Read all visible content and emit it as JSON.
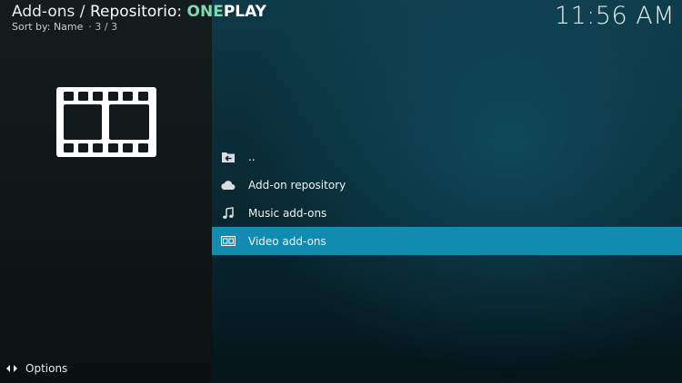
{
  "header": {
    "prefix": "Add-ons / ",
    "repo_label": "Repositorio: ",
    "repo_name_accent": "ONE",
    "repo_name_rest": "PLAY",
    "sort_label": "Sort by: Name",
    "count": "· 3 / 3"
  },
  "clock": "11:56 AM",
  "list": {
    "items": [
      {
        "label": "..",
        "icon": "folder-back-icon",
        "focused": false
      },
      {
        "label": "Add-on repository",
        "icon": "cloud-icon",
        "focused": false
      },
      {
        "label": "Music add-ons",
        "icon": "music-note-icon",
        "focused": false
      },
      {
        "label": "Video add-ons",
        "icon": "video-icon",
        "focused": true
      }
    ]
  },
  "preview_icon": "film-strip-icon",
  "footer": {
    "options_label": "Options",
    "options_icon": "options-arrows-icon"
  },
  "colors": {
    "focus_bar": "#128bb0",
    "accent_text": "#7fd9b0"
  }
}
